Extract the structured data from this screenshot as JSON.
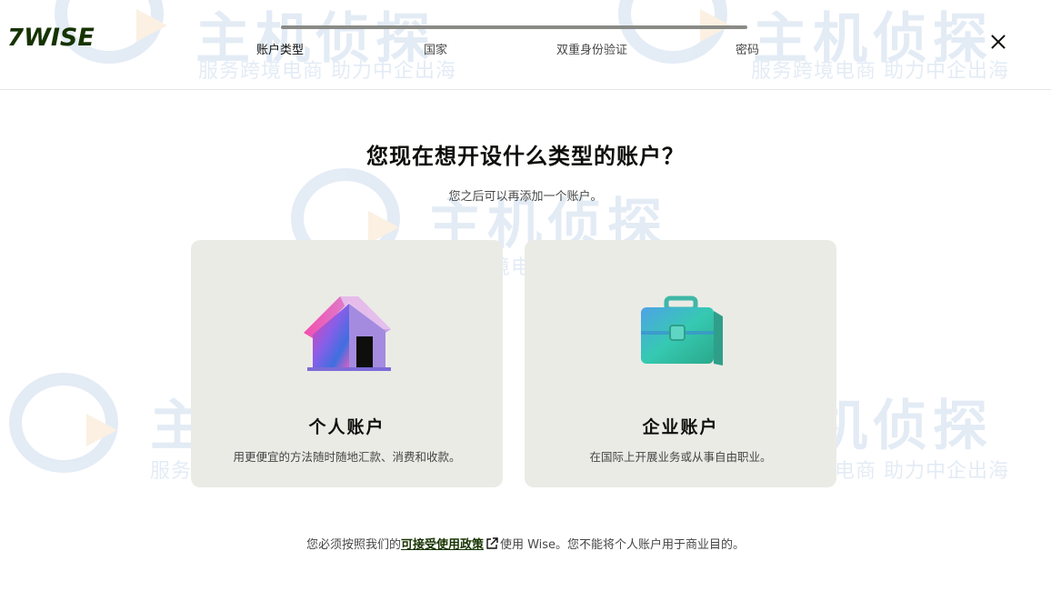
{
  "brand": {
    "logo_flag": "7",
    "logo_text": "WISE",
    "accent": "#163300"
  },
  "stepper": {
    "steps": [
      {
        "label": "账户类型",
        "active": true
      },
      {
        "label": "国家",
        "active": false
      },
      {
        "label": "双重身份验证",
        "active": false
      },
      {
        "label": "密码",
        "active": false
      }
    ]
  },
  "close": {
    "icon": "close-icon"
  },
  "main": {
    "title": "您现在想开设什么类型的账户？",
    "subtitle": "您之后可以再添加一个账户。"
  },
  "cards": {
    "personal": {
      "title": "个人账户",
      "description": "用更便宜的方法随时随地汇款、消费和收款。",
      "icon": "house-icon"
    },
    "business": {
      "title": "企业账户",
      "description": "在国际上开展业务或从事自由职业。",
      "icon": "briefcase-icon"
    }
  },
  "footer": {
    "prefix": "您必须按照我们的",
    "link": "可接受使用政策",
    "suffix": "使用 Wise。您不能将个人账户用于商业目的。",
    "link_icon": "external-link-icon"
  },
  "watermark": {
    "main": "主机侦探",
    "tagline": "服务跨境电商 助力中企出海"
  }
}
